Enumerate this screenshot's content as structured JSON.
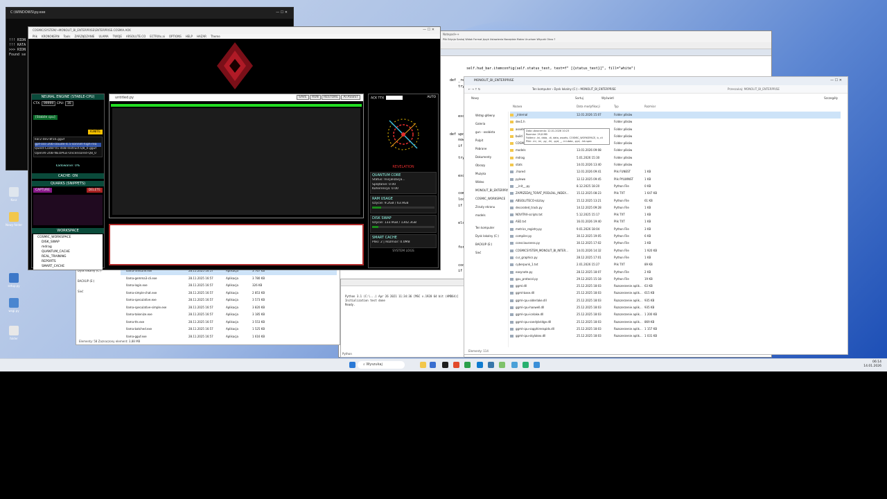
{
  "cmd": {
    "title": "C:\\WINDOWS\\py.exe",
    "lines": [
      "!!! RIDN",
      "!!! KATA",
      ">>> RIDN",
      "Found se"
    ]
  },
  "npp": {
    "title": "Notepad++",
    "menu": "Plik  Edycja  Szukaj  Widok  Format  Język  Ustawienia  Narzędzia  Makro  Uruchom  Wtyczki  Okno  ?",
    "code": [
      "            self.hud_bar.itemconfig(self.status_text, text=f\" [{status_text}]\", fill=\"white\")",
      "",
      "    def _refresh_hardware_stats(self):",
      "        try:",
      "            if",
      "",
      "            els",
      "",
      "        except",
      "            pas",
      "",
      "    def update_",
      "        now = t",
      "        if (now",
      "            retu",
      "        try:",
      "            cor",
      "",
      "        except",
      "            cod",
      "",
      "        compact",
      "        local_c",
      "        if tota",
      "            cnt",
      "            uni",
      "        else:",
      "            cha",
      "            cnt",
      "            uni",
      "        for",
      "",
      "",
      "        code_con",
      "        if not",
      "            code",
      "        code_con"
    ]
  },
  "exback": {
    "status": "Elementy: 58    Zaznaczony element: 3,88 MB",
    "files": [
      {
        "n": "llama-finetune.exe",
        "d": "28.11.2025 16:57",
        "t": "Aplikacja",
        "s": "3 767 KB"
      },
      {
        "n": "llama-gemma3-cli.exe",
        "d": "28.11.2025 16:57",
        "t": "Aplikacja",
        "s": "3 780 KB"
      },
      {
        "n": "llama-login.exe",
        "d": "28.11.2025 16:57",
        "t": "Aplikacja",
        "s": "326 KB"
      },
      {
        "n": "llama-simple-chat.exe",
        "d": "28.11.2025 16:57",
        "t": "Aplikacja",
        "s": "2 853 KB"
      },
      {
        "n": "llama-speculative.exe",
        "d": "28.11.2025 16:57",
        "t": "Aplikacja",
        "s": "3 573 KB"
      },
      {
        "n": "llama-speculative-simple.exe",
        "d": "28.11.2025 16:57",
        "t": "Aplikacja",
        "s": "3 820 KB"
      },
      {
        "n": "llama-tokenize.exe",
        "d": "28.11.2025 16:57",
        "t": "Aplikacja",
        "s": "3 185 KB"
      },
      {
        "n": "llama-tts.exe",
        "d": "28.11.2025 16:57",
        "t": "Aplikacja",
        "s": "3 553 KB"
      },
      {
        "n": "llama-batched.exe",
        "d": "28.11.2025 16:57",
        "t": "Aplikacja",
        "s": "1 525 KB"
      },
      {
        "n": "llama-gguf.exe",
        "d": "28.11.2025 16:57",
        "t": "Aplikacja",
        "s": "1 616 KB"
      }
    ],
    "nav": [
      "Dysk lokalny (C:)",
      "BACKUP (E:)",
      "Sieć"
    ]
  },
  "app": {
    "title": "COSMIC/SYSTEM/→MONOLIT_BI_ENTERPRISE\\ENTERPRISE.COSMIA.AOK",
    "menu": [
      "Plik",
      "KRONOKERN",
      "Tools",
      "ZARZĄDZANIE",
      "ULAMA",
      "TWOJE",
      "ARSOLUTE.CO",
      "ECTRIXx.ai",
      "OPTIONS",
      "HELP",
      "HAZAR",
      "Theme"
    ],
    "neural": {
      "header": "NEURAL ENGINE (STABLE-CPU)",
      "ctx_label": "CTX:",
      "ctx": "99999",
      "cpu_label": "CPU:",
      "cpu": "16",
      "mode": "[Stabile cpu]",
      "ignite": "IGNITE",
      "models": [
        "llar2-dev-8f16.gguf",
        "gpt-oss-20b-claude-4.5-sonnet-high-rea",
        "Quest-Coder-V1-40B-Instruct.Q8_0.gguf",
        "OpenAI-20B-NEOPlus-Uncensored-Q8_0"
      ],
      "loading": "Ładowanie: 0%"
    },
    "cache": "CACHE: ON",
    "quarks": {
      "header": "QUARKS (SNIPPETS)",
      "capture": "CAPTURE",
      "delete": "DELETE"
    },
    "workspace": {
      "header": "WORKSPACE",
      "items": [
        "COSMIC_WORKSPACE",
        "DISK_SWAP",
        "mdrag",
        "QUANTUM_CACHE",
        "REAL_TRAINING",
        "REPORTS",
        "SMART_CACHE"
      ]
    },
    "editor": {
      "file": "untitled.py",
      "buttons": [
        "SAVE",
        "RUN",
        "RESTORE",
        "AI ASSIST"
      ]
    },
    "right": {
      "ack": "ACK TTX",
      "auto": "AUTO",
      "revelation": "REVELATION",
      "quantum": {
        "title": "QUANTUM CORE",
        "status": "Status: Inicjalizacja...",
        "l2": "Splątanie: 0.00",
        "l3": "Koherencja: 0.00"
      },
      "ram": {
        "title": "RAM USAGE",
        "text": "Użycie: 9.2GB / 63.9GB",
        "pct": 14
      },
      "swap": {
        "title": "DISK SWAP",
        "text": "Użycie: 133.9GB / 1302.3GB",
        "pct": 10
      },
      "smart": {
        "title": "SMART CACHE",
        "text": "Pliki: 2 | Rozmiar: 0.0MB"
      },
      "logs": "SYSTEM LOGS"
    }
  },
  "py": {
    "title": "Python",
    "lines": [
      "Python 3.1 (C:\\...) Apr 26 2021 11:34:36 [MSC v.1928 64 bit (AMD64)] on win32",
      "Initialization test done",
      "Ready."
    ]
  },
  "ex": {
    "title": "MONOLIT_BI_ENTERPRISE",
    "new": "Nowy",
    "sort": "Sortuj",
    "view": "Wyświetl",
    "details": "Szczegóły",
    "path": [
      "Ten komputer",
      "Dysk lokalny (C:)",
      "MONOLIT_BI_ENTERPRISE"
    ],
    "search": "Przeszukaj: MONOLIT_BI_ENTERPRISE",
    "cols": [
      "Nazwa",
      "Data modyfikacji",
      "Typ",
      "Rozmiar"
    ],
    "side": [
      "Wstęp główny",
      "Galeria",
      "gun - osobista",
      "Pulpit",
      "Pobrane",
      "Dokumenty",
      "Obrazy",
      "Muzyka",
      "Wideo",
      "MONOLIT_BI_ENTERPRISE",
      "COSMIC_WORKSPACE",
      "Zrzuty ekranu",
      "models",
      "Ten komputer",
      "Dysk lokalny (C:)",
      "BACKUP (E:)",
      "Sieć"
    ],
    "tooltip": [
      "Data utworzenia: 12.01.2026 10:23",
      "Rozmiar: 29,8 MB",
      "Foldery: .ini, data, .di, data, assets, COSMIC_WORKSPACE, b, cli",
      "Pliki: .ini, .ini, .py, .ihl, .pyd, _, .ini.data, .pyd, .lnk.spec"
    ],
    "status": "Elementy: 114",
    "files": [
      {
        "n": "_internal",
        "d": "12.01.2026 15:07",
        "t": "Folder plików",
        "s": "",
        "f": 1
      },
      {
        "n": "dev1.h",
        "d": "",
        "t": "Folder plików",
        "s": "",
        "f": 1
      },
      {
        "n": "assets",
        "d": "",
        "t": "Folder plików",
        "s": "",
        "f": 1
      },
      {
        "n": "build",
        "d": "",
        "t": "Folder plików",
        "s": "",
        "f": 1
      },
      {
        "n": "COSMIC_WORKSPACE",
        "d": "14.01.2026 15:04",
        "t": "Folder plików",
        "s": "",
        "f": 1
      },
      {
        "n": "models",
        "d": "13.01.2026 09:08",
        "t": "Folder plików",
        "s": "",
        "f": 1
      },
      {
        "n": "mdrag",
        "d": "5.01.2026 15:30",
        "t": "Folder plików",
        "s": "",
        "f": 1
      },
      {
        "n": "stats",
        "d": "14.01.2026 13:40",
        "t": "Folder plików",
        "s": "",
        "f": 1
      },
      {
        "n": ".ihared",
        "d": "12.01.2026 09:41",
        "t": "Plik FUNEST",
        "s": "1 KB"
      },
      {
        "n": "pylewo",
        "d": "12.12.2025 09:45",
        "t": "Plik PYLWINST",
        "s": "1 KB"
      },
      {
        "n": "__init__.py",
        "d": "8.12.2025 18:20",
        "t": "Python File",
        "s": "0 KB"
      },
      {
        "n": "ZAPRZEDAJ_TORAT_PODLOŁL_INDEX...",
        "d": "15.12.2025 08:23",
        "t": "Plik TXT",
        "s": "1 647 KB"
      },
      {
        "n": "ABSOLUTECO-kiLitay",
        "d": "15.12.2025 13:21",
        "t": "Python File",
        "s": "61 KB"
      },
      {
        "n": "decorated_track.py",
        "d": "14.12.2025 09:28",
        "t": "Python File",
        "s": "1 KB"
      },
      {
        "n": "NOVITAX-scripts.txt",
        "d": "5.12.2025 15:17",
        "t": "Plik TXT",
        "s": "1 KB"
      },
      {
        "n": "ASD.txt",
        "d": "16.01.2026 19:40",
        "t": "Plik TXT",
        "s": "1 KB"
      },
      {
        "n": "metrics_registry.py",
        "d": "9.01.2026 18:04",
        "t": "Python File",
        "s": "3 KB"
      },
      {
        "n": "compiler.py",
        "d": "30.12.2025 19:05",
        "t": "Python File",
        "s": "6 KB"
      },
      {
        "n": "consciousness.py",
        "d": "30.12.2025 17:02",
        "t": "Python File",
        "s": "3 KB"
      },
      {
        "n": "COSMICSYSTEM_MONOLIT_BI_INTER...",
        "d": "14.01.2026 14:32",
        "t": "Python File",
        "s": "1 920 KB"
      },
      {
        "n": "cur_graphics.py",
        "d": "28.12.2025 17:01",
        "t": "Python File",
        "s": "1 KB"
      },
      {
        "n": "cyberpunk_1.txt",
        "d": "2.01.2026 15:27",
        "t": "Plik TXT",
        "s": "89 KB"
      },
      {
        "n": "easynote.py",
        "d": "28.12.2025 18:07",
        "t": "Python File",
        "s": "2 KB"
      },
      {
        "n": "gpu_protocol.py",
        "d": "29.12.2025 15:18",
        "t": "Python File",
        "s": "19 KB"
      },
      {
        "n": "ggml.dll",
        "d": "25.12.2025 18:03",
        "t": "Rozszerzenie aplik...",
        "s": "63 KB"
      },
      {
        "n": "ggml-base.dll",
        "d": "25.12.2025 18:03",
        "t": "Rozszerzenie aplik...",
        "s": "615 KB"
      },
      {
        "n": "ggml-cpu-alderlake.dll",
        "d": "25.12.2025 18:03",
        "t": "Rozszerzenie aplik...",
        "s": "935 KB"
      },
      {
        "n": "ggml-cpu-haswell.dll",
        "d": "25.12.2025 18:03",
        "t": "Rozszerzenie aplik...",
        "s": "935 KB"
      },
      {
        "n": "ggml-cpu-icelake.dll",
        "d": "25.12.2025 18:03",
        "t": "Rozszerzenie aplik...",
        "s": "1 200 KB"
      },
      {
        "n": "ggml-cpu-sandybridge.dll",
        "d": "25.12.2025 18:03",
        "t": "Rozszerzenie aplik...",
        "s": "869 KB"
      },
      {
        "n": "ggml-cpu-sapphirerapids.dll",
        "d": "25.12.2025 18:03",
        "t": "Rozszerzenie aplik...",
        "s": "1 157 KB"
      },
      {
        "n": "ggml-cpu-skylakex.dll",
        "d": "25.12.2025 18:03",
        "t": "Rozszerzenie aplik...",
        "s": "1 031 KB"
      }
    ]
  },
  "desk": [
    {
      "l": "Kosz"
    },
    {
      "l": "Nowy folder"
    },
    {
      "l": "Nowy folder"
    },
    {
      "l": "setup.py"
    },
    {
      "l": "wsgi.py"
    },
    {
      "l": "folder"
    }
  ],
  "taskbar": {
    "search": "Wyszukaj",
    "time": "06:14",
    "date": "14.01.2026"
  }
}
